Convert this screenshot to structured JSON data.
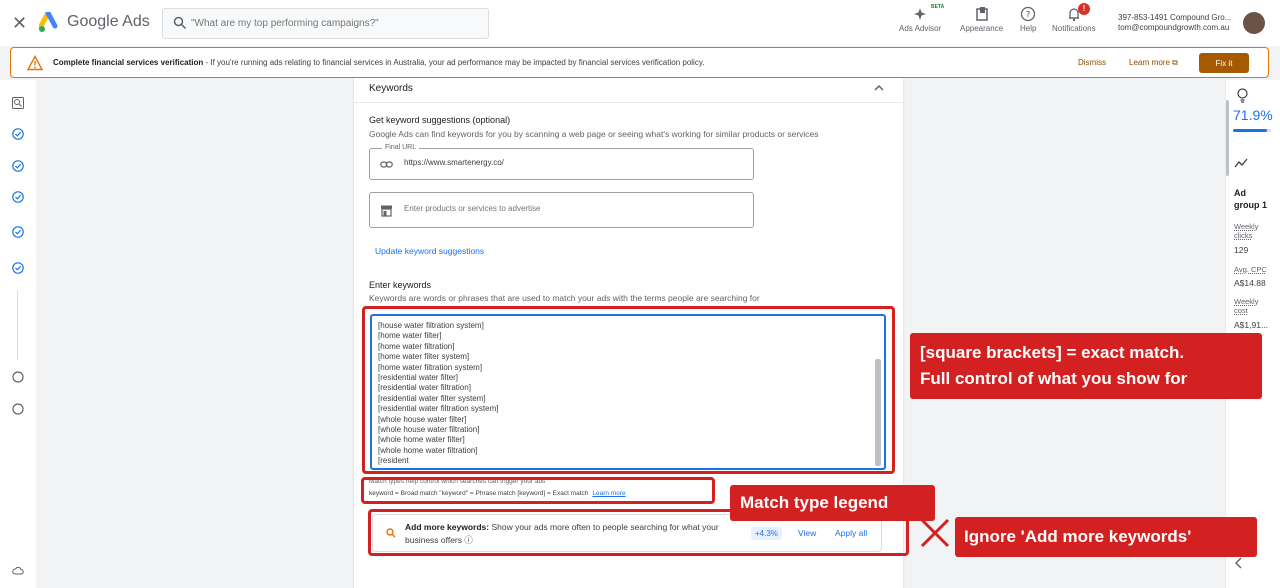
{
  "topbar": {
    "brand": "Google Ads",
    "search_placeholder": "\"What are my top performing campaigns?\"",
    "beta": "BETA",
    "items": [
      {
        "label": "Ads Advisor"
      },
      {
        "label": "Appearance"
      },
      {
        "label": "Help"
      },
      {
        "label": "Notifications"
      }
    ],
    "notification_badge": "!",
    "account_line1": "397-853-1491 Compound Gro...",
    "account_line2": "tom@compoundgrowth.com.au"
  },
  "banner": {
    "title": "Complete financial services verification",
    "text": " - If you're running ads relating to financial services in Australia, your ad performance may be impacted by financial services verification policy.",
    "dismiss": "Dismiss",
    "learn_more": "Learn more",
    "fix_it": "Fix it"
  },
  "card": {
    "title": "Keywords",
    "suggest_heading": "Get keyword suggestions (optional)",
    "suggest_sub": "Google Ads can find keywords for you by scanning a web page or seeing what's working for similar products or services",
    "final_url_label": "Final URL",
    "final_url_value": "https://www.smartenergy.co/",
    "products_placeholder": "Enter products or services to advertise",
    "update_link": "Update keyword suggestions",
    "enter_heading": "Enter keywords",
    "enter_sub": "Keywords are words or phrases that are used to match your ads with the terms people are searching for",
    "keywords": [
      "[house water filtration system]",
      "[home water filter]",
      "[home water filtration]",
      "[home water filter system]",
      "[home water filtration system]",
      "[residential water filter]",
      "[residential water filtration]",
      "[residential water filter system]",
      "[residential water filtration system]",
      "[whole house water filter]",
      "[whole house water filtration]",
      "[whole home water filter]",
      "[whole home water filtration]",
      "[resident"
    ],
    "legend_line1": "Match types help control which searches can trigger your ads",
    "legend_line2": "keyword = Broad match   \"keyword\" = Phrase match   [keyword] = Exact match",
    "legend_learn": "Learn more",
    "addmore_bold": "Add more keywords:",
    "addmore_text": " Show your ads more often to people searching for what your business offers",
    "addmore_chip": "+4.3%",
    "view": "View",
    "apply_all": "Apply all"
  },
  "rightpanel": {
    "score": "71.9%",
    "score_fraction": 0.9,
    "title_line1": "Ad",
    "title_line2": "group 1",
    "weekly_clicks_l1": "Weekly",
    "weekly_clicks_l2": "clicks",
    "weekly_clicks": "129",
    "avg_cpc_label": "Avg. CPC",
    "avg_cpc": "A$14.88",
    "weekly_cost_l1": "Weekly",
    "weekly_cost_l2": "cost",
    "weekly_cost": "A$1,91..."
  },
  "annotations": {
    "callout1_line1": "[square brackets] = exact match.",
    "callout1_line2": "Full control of what you show for",
    "callout2": "Match type legend",
    "callout3": "Ignore 'Add more keywords'"
  },
  "colors": {
    "accent": "#1a73e8",
    "annotation_red": "#d32020",
    "warning": "#e37400"
  }
}
